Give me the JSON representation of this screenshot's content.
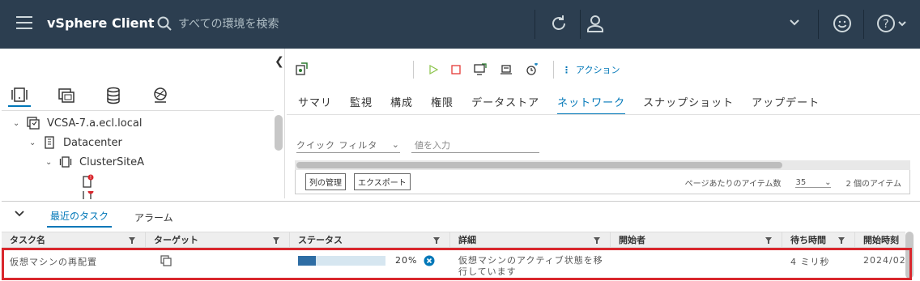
{
  "header": {
    "title": "vSphere Client",
    "search_placeholder": "すべての環境を検索"
  },
  "left": {
    "tree": [
      {
        "label": "VCSA-7.a.ecl.local",
        "level": 0,
        "caret": "⌄"
      },
      {
        "label": "Datacenter",
        "level": 1,
        "caret": "⌄"
      },
      {
        "label": "ClusterSiteA",
        "level": 2,
        "caret": "⌄"
      }
    ]
  },
  "right": {
    "actions_label": "アクション",
    "tabs": [
      "サマリ",
      "監視",
      "構成",
      "権限",
      "データストア",
      "ネットワーク",
      "スナップショット",
      "アップデート"
    ],
    "active_tab": "ネットワーク",
    "filter_label": "クイック フィルタ",
    "filter_placeholder": "値を入力",
    "manage_columns": "列の管理",
    "export": "エクスポート",
    "items_per_page_label": "ページあたりのアイテム数",
    "items_per_page": "35",
    "item_count": "2 個のアイテム"
  },
  "bottom": {
    "tabs": [
      "最近のタスク",
      "アラーム"
    ],
    "columns": [
      "タスク名",
      "ターゲット",
      "ステータス",
      "詳細",
      "開始者",
      "待ち時間",
      "開始時刻"
    ],
    "row": {
      "task_name": "仮想マシンの再配置",
      "status_percent": "20%",
      "progress": 0.2,
      "details": "仮想マシンのアクティブ状態を移行しています",
      "initiator": "",
      "wait_time": "4 ミリ秒",
      "start_time": "2024/02"
    }
  },
  "colors": {
    "header_bg": "#2c3e50",
    "accent": "#0077b8",
    "highlight": "#d9272d",
    "progress_fill": "#2e6da4"
  }
}
